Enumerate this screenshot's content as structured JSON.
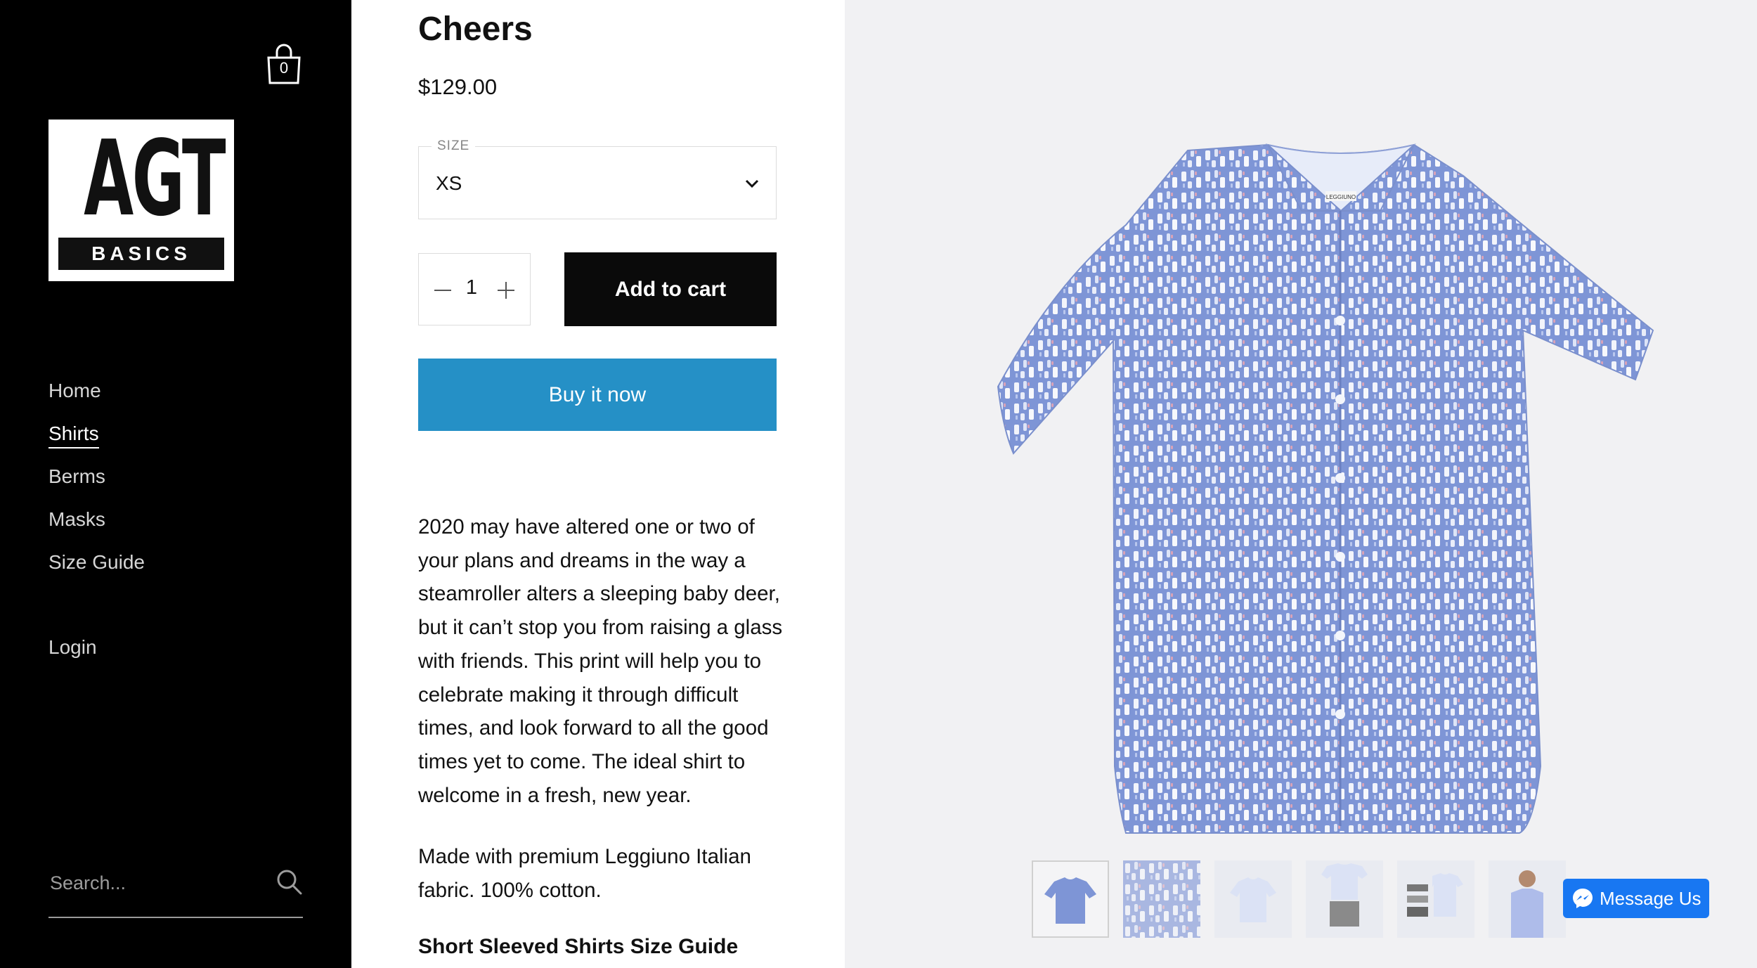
{
  "cart": {
    "count": "0"
  },
  "logo": {
    "line1": "AGT",
    "line2": "BASICS"
  },
  "nav": {
    "items": [
      {
        "label": "Home",
        "active": false
      },
      {
        "label": "Shirts",
        "active": true
      },
      {
        "label": "Berms",
        "active": false
      },
      {
        "label": "Masks",
        "active": false
      },
      {
        "label": "Size Guide",
        "active": false
      }
    ],
    "login": "Login"
  },
  "search": {
    "placeholder": "Search..."
  },
  "product": {
    "title": "Cheers",
    "price": "$129.00",
    "size": {
      "label": "SIZE",
      "selected": "XS"
    },
    "quantity": "1",
    "add_to_cart": "Add to cart",
    "buy_now": "Buy it now",
    "description": "2020 may have altered one or two of your plans and dreams in the way a steamroller alters a sleeping baby deer, but it can’t stop you from raising a glass with friends. This print will help you to celebrate making it through difficult times, and look forward to all the good times yet to come. The ideal shirt to welcome in a fresh, new year.",
    "fabric": "Made with premium Leggiuno Italian fabric. 100% cotton.",
    "size_guide_heading": "Short Sleeved Shirts Size Guide"
  },
  "gallery": {
    "shirt_label": "LEGGIUNO",
    "thumbnail_count": 6
  },
  "messenger": {
    "label": "Message Us"
  },
  "colors": {
    "sidebar": "#000000",
    "cart_button": "#0a0a0a",
    "buy_button": "#2590c6",
    "messenger": "#1877f2",
    "shirt": "#7e95d6"
  }
}
